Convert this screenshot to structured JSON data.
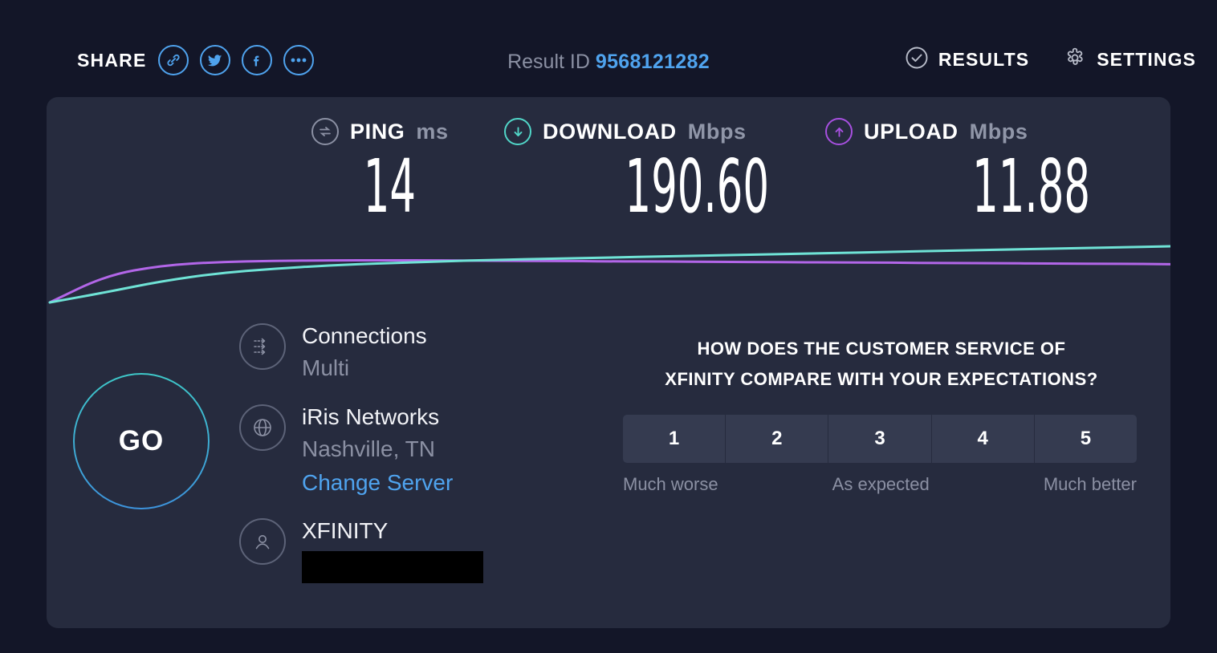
{
  "topbar": {
    "share_label": "SHARE",
    "share_icons": [
      {
        "name": "link-icon"
      },
      {
        "name": "twitter-icon"
      },
      {
        "name": "facebook-icon"
      },
      {
        "name": "more-options-icon"
      }
    ],
    "result_id_label": "Result ID",
    "result_id_value": "9568121282",
    "results_label": "RESULTS",
    "settings_label": "SETTINGS"
  },
  "metrics": {
    "ping": {
      "title": "PING",
      "unit": "ms",
      "value": "14",
      "color": "#8b90a3"
    },
    "download": {
      "title": "DOWNLOAD",
      "unit": "Mbps",
      "value": "190.60",
      "color": "#51d6c8"
    },
    "upload": {
      "title": "UPLOAD",
      "unit": "Mbps",
      "value": "11.88",
      "color": "#a750e0"
    }
  },
  "go": {
    "label": "GO"
  },
  "info": {
    "connections": {
      "primary": "Connections",
      "secondary": "Multi"
    },
    "server": {
      "primary": "iRis Networks",
      "secondary": "Nashville, TN",
      "link": "Change Server"
    },
    "isp": {
      "primary": "XFINITY",
      "secondary": ""
    }
  },
  "survey": {
    "question_line1": "HOW DOES THE CUSTOMER SERVICE OF",
    "question_line2": "XFINITY COMPARE WITH YOUR EXPECTATIONS?",
    "ratings": [
      "1",
      "2",
      "3",
      "4",
      "5"
    ],
    "label_low": "Much worse",
    "label_mid": "As expected",
    "label_high": "Much better"
  },
  "chart_data": {
    "type": "line",
    "title": "",
    "xlabel": "",
    "ylabel": "",
    "grid": false,
    "legend": "none",
    "series": [
      {
        "name": "download",
        "color": "#6fe3d6",
        "values": [
          0,
          18,
          38,
          52,
          60,
          66,
          70,
          73,
          76,
          78,
          80,
          82,
          84,
          86,
          88,
          90,
          92,
          94,
          96,
          98,
          100
        ]
      },
      {
        "name": "upload",
        "color": "#b266e8",
        "values": [
          0,
          48,
          66,
          72,
          74,
          75,
          75,
          75,
          74,
          74,
          73,
          73,
          72,
          72,
          71,
          71,
          70,
          70,
          69,
          69,
          68
        ]
      }
    ]
  },
  "colors": {
    "page_background": "#131628",
    "card_background": "#262b3e",
    "accent_blue": "#4fa3ee",
    "accent_teal": "#51d6c8",
    "accent_purple": "#a750e0",
    "muted_text": "#8b90a3"
  }
}
